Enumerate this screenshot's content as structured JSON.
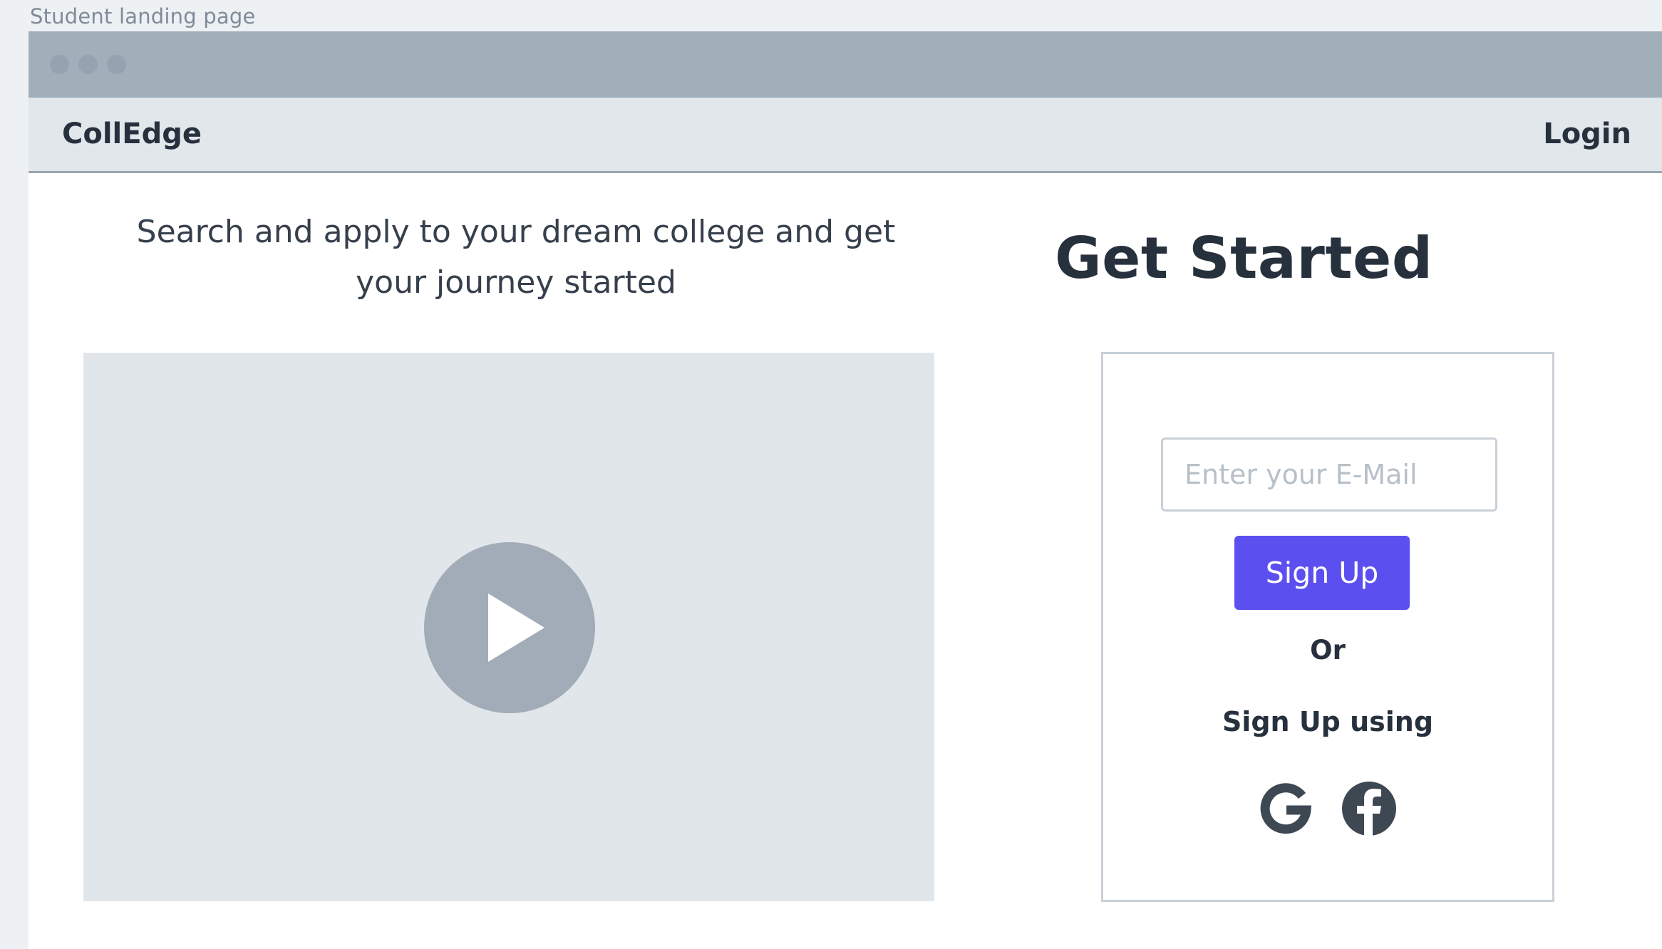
{
  "frame": {
    "label": "Student landing page"
  },
  "navbar": {
    "brand": "CollEdge",
    "login_label": "Login"
  },
  "hero": {
    "tagline_line1": "Search and apply to your dream college and get",
    "tagline_line2": "your journey started"
  },
  "video": {
    "play_icon": "play-icon"
  },
  "signup": {
    "heading": "Get Started",
    "email_placeholder": "Enter your E-Mail",
    "email_value": "",
    "button_label": "Sign Up",
    "or_text": "Or",
    "social_label": "Sign Up using",
    "social_icons": [
      "google-icon",
      "facebook-icon"
    ]
  },
  "colors": {
    "accent": "#5b4ff0",
    "titlebar": "#a1afbb",
    "navbar": "#e2e7ec",
    "video_placeholder": "#e1e6eb",
    "text_dark": "#27313d"
  }
}
